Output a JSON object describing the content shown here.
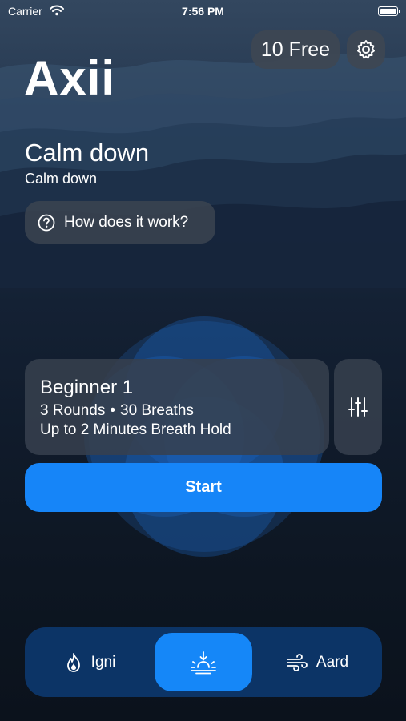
{
  "status_bar": {
    "carrier": "Carrier",
    "time": "7:56 PM"
  },
  "header": {
    "free_label": "10 Free",
    "settings_icon": "gear-icon"
  },
  "app_title": "Axii",
  "mode": {
    "title": "Calm down",
    "subtitle": "Calm down"
  },
  "help": {
    "label": "How does it work?",
    "icon": "question-circle-icon"
  },
  "session": {
    "title": "Beginner 1",
    "rounds": "3 Rounds",
    "separator": "•",
    "breaths": "30 Breaths",
    "hold": "Up to 2 Minutes Breath Hold",
    "adjust_icon": "sliders-icon"
  },
  "start_label": "Start",
  "tabs": [
    {
      "label": "Igni",
      "icon": "flame-icon",
      "selected": false
    },
    {
      "label": "",
      "icon": "sunset-icon",
      "selected": true
    },
    {
      "label": "Aard",
      "icon": "wind-icon",
      "selected": false
    }
  ],
  "colors": {
    "accent": "#1685f8",
    "tabbar": "#0c3466",
    "card": "#37404e"
  }
}
